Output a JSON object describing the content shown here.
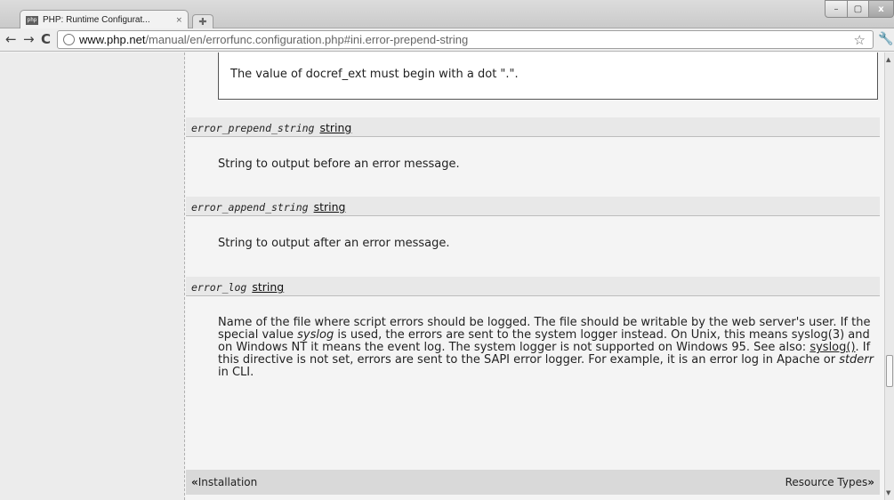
{
  "tab": {
    "favicon_text": "php",
    "title": "PHP: Runtime Configurat...",
    "close": "×"
  },
  "window": {
    "min": "–",
    "max": "▢",
    "close": "x"
  },
  "toolbar": {
    "url_host": "www.php.net",
    "url_path": "/manual/en/errorfunc.configuration.php#ini.error-prepend-string"
  },
  "warning": {
    "text": "The value of docref_ext must begin with a dot \".\"."
  },
  "directives": [
    {
      "name": "error_prepend_string",
      "type": "string",
      "description": "String to output before an error message."
    },
    {
      "name": "error_append_string",
      "type": "string",
      "description": "String to output after an error message."
    },
    {
      "name": "error_log",
      "type": "string",
      "description": {
        "part1": "Name of the file where script errors should be logged. The file should be writable by the web server's user. If the special value ",
        "em1": "syslog",
        "part2": " is used, the errors are sent to the system logger instead. On Unix, this means syslog(3) and on Windows NT it means the event log. The system logger is not supported on Windows 95. See also: ",
        "link": "syslog()",
        "part3": ". If this directive is not set, errors are sent to the SAPI error logger. For example, it is an error log in Apache or ",
        "em2": "stderr",
        "part4": " in CLI."
      }
    }
  ],
  "footer": {
    "prev": "Installation",
    "next": "Resource Types"
  }
}
